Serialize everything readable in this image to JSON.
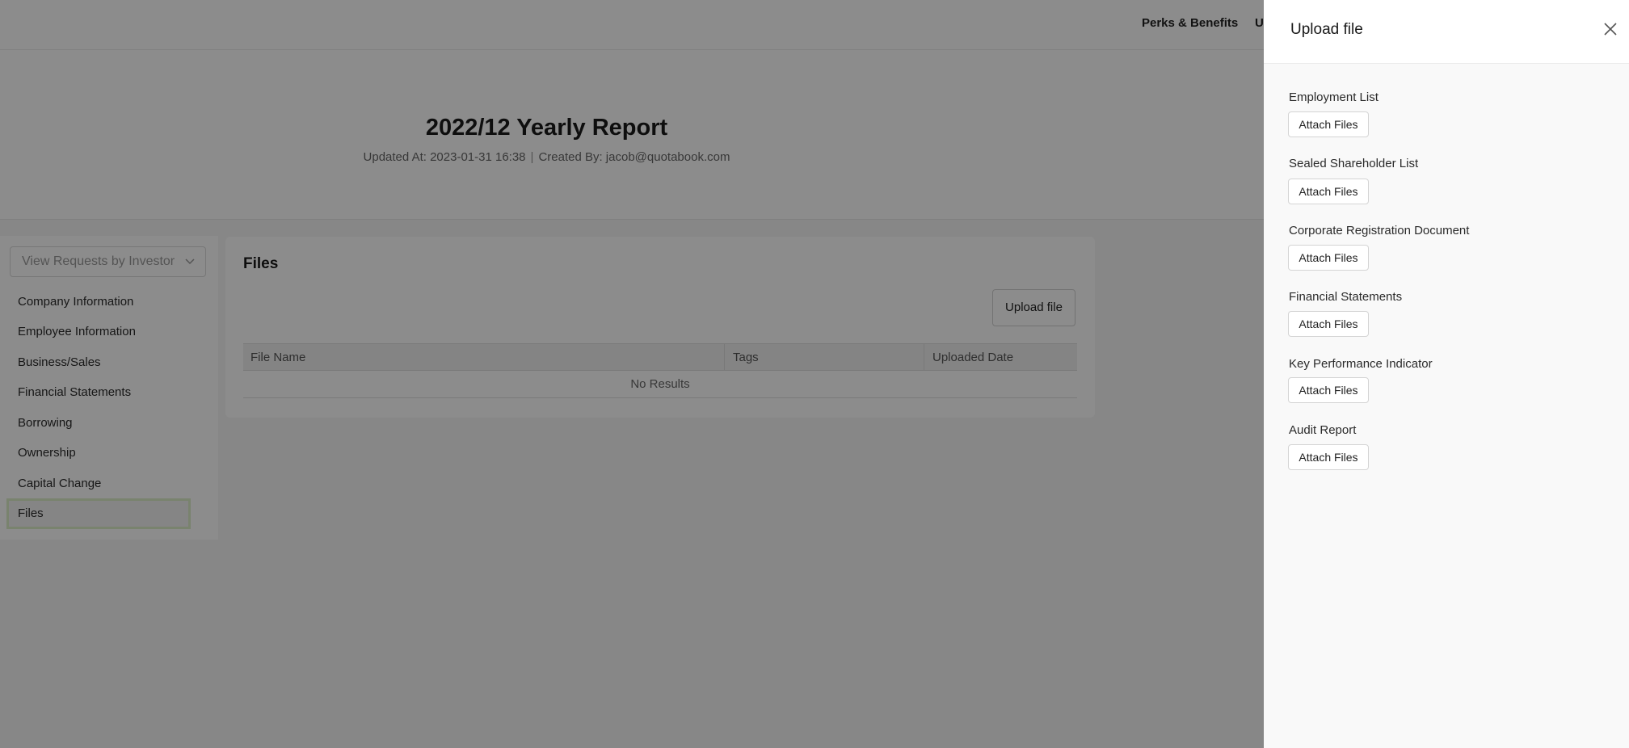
{
  "topnav": {
    "perks": "Perks & Benefits",
    "partial": "U"
  },
  "report": {
    "title": "2022/12 Yearly Report",
    "updated": "Updated At: 2023-01-31 16:38",
    "separator": "|",
    "created": "Created By: jacob@quotabook.com"
  },
  "sidebar": {
    "investor_select": "View Requests by Investor",
    "items": [
      {
        "label": "Company Information"
      },
      {
        "label": "Employee Information"
      },
      {
        "label": "Business/Sales"
      },
      {
        "label": "Financial Statements"
      },
      {
        "label": "Borrowing"
      },
      {
        "label": "Ownership"
      },
      {
        "label": "Capital Change"
      },
      {
        "label": "Files"
      }
    ]
  },
  "files": {
    "title": "Files",
    "upload_label": "Upload file",
    "columns": [
      "File Name",
      "Tags",
      "Uploaded Date"
    ],
    "empty_text": "No Results"
  },
  "drawer": {
    "title": "Upload file",
    "fields": [
      {
        "label": "Employment List",
        "button": "Attach Files"
      },
      {
        "label": "Sealed Shareholder List",
        "button": "Attach Files"
      },
      {
        "label": "Corporate Registration Document",
        "button": "Attach Files"
      },
      {
        "label": "Financial Statements",
        "button": "Attach Files"
      },
      {
        "label": "Key Performance Indicator",
        "button": "Attach Files"
      },
      {
        "label": "Audit Report",
        "button": "Attach Files"
      }
    ]
  }
}
